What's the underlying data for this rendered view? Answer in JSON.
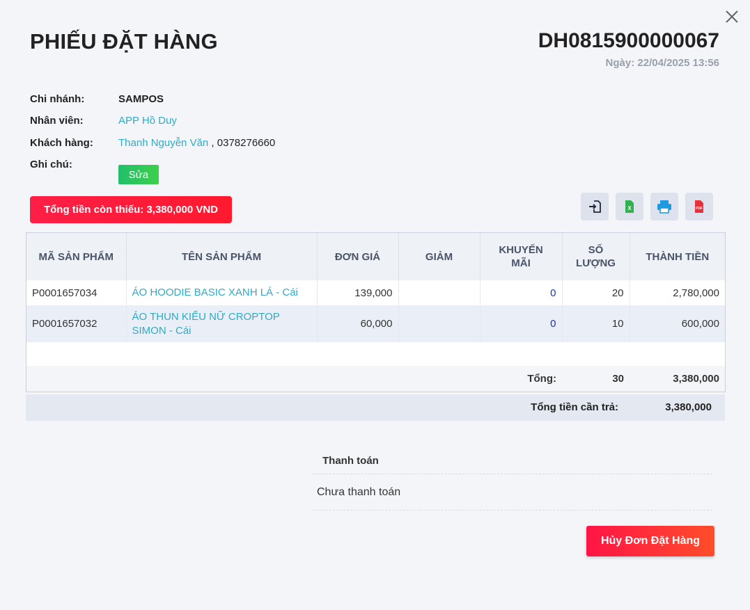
{
  "header": {
    "title": "PHIẾU ĐẶT HÀNG",
    "order_code": "DH0815900000067",
    "date_label": "Ngày: 22/04/2025 13:56"
  },
  "info": {
    "branch_label": "Chi nhánh:",
    "branch_value": "SAMPOS",
    "staff_label": "Nhân viên:",
    "staff_value": "APP Hồ Duy",
    "customer_label": "Khách hàng:",
    "customer_name": "Thanh Nguyễn Văn",
    "customer_phone": " , 0378276660",
    "note_label": "Ghi chú:",
    "edit_label": "Sửa"
  },
  "missing_total": "Tổng tiền còn thiếu: 3,380,000 VND",
  "toolbar": {
    "icons": [
      "import-icon",
      "excel-icon",
      "print-icon",
      "pdf-icon"
    ],
    "excel_glyph": "X",
    "pdf_glyph": "PDF"
  },
  "table": {
    "headers": {
      "code": "MÃ SẢN PHẨM",
      "name": "TÊN SẢN PHẨM",
      "price": "ĐƠN GIÁ",
      "discount": "GIẢM",
      "promo_1": "KHUYẾN",
      "promo_2": "MÃI",
      "qty_1": "SỐ",
      "qty_2": "LƯỢNG",
      "amount": "THÀNH TIỀN"
    },
    "rows": [
      {
        "code": "P0001657034",
        "name": "ÁO HOODIE BASIC XANH LÁ - Cái",
        "price": "139,000",
        "discount": "",
        "promo": "0",
        "qty": "20",
        "amount": "2,780,000"
      },
      {
        "code": "P0001657032",
        "name": "ÁO THUN KIỂU NỮ CROPTOP SIMON - Cái",
        "price": "60,000",
        "discount": "",
        "promo": "0",
        "qty": "10",
        "amount": "600,000"
      }
    ],
    "total_label": "Tổng:",
    "total_qty": "30",
    "total_amount": "3,380,000",
    "grand_label": "Tổng tiền cần trả:",
    "grand_value": "3,380,000"
  },
  "payment": {
    "title": "Thanh toán",
    "status": "Chưa thanh toán"
  },
  "actions": {
    "cancel_label": "Hủy Đơn Đặt Hàng"
  },
  "colors": {
    "link": "#2eabc5",
    "danger": "#ff1e46",
    "success": "#20bf6b"
  }
}
